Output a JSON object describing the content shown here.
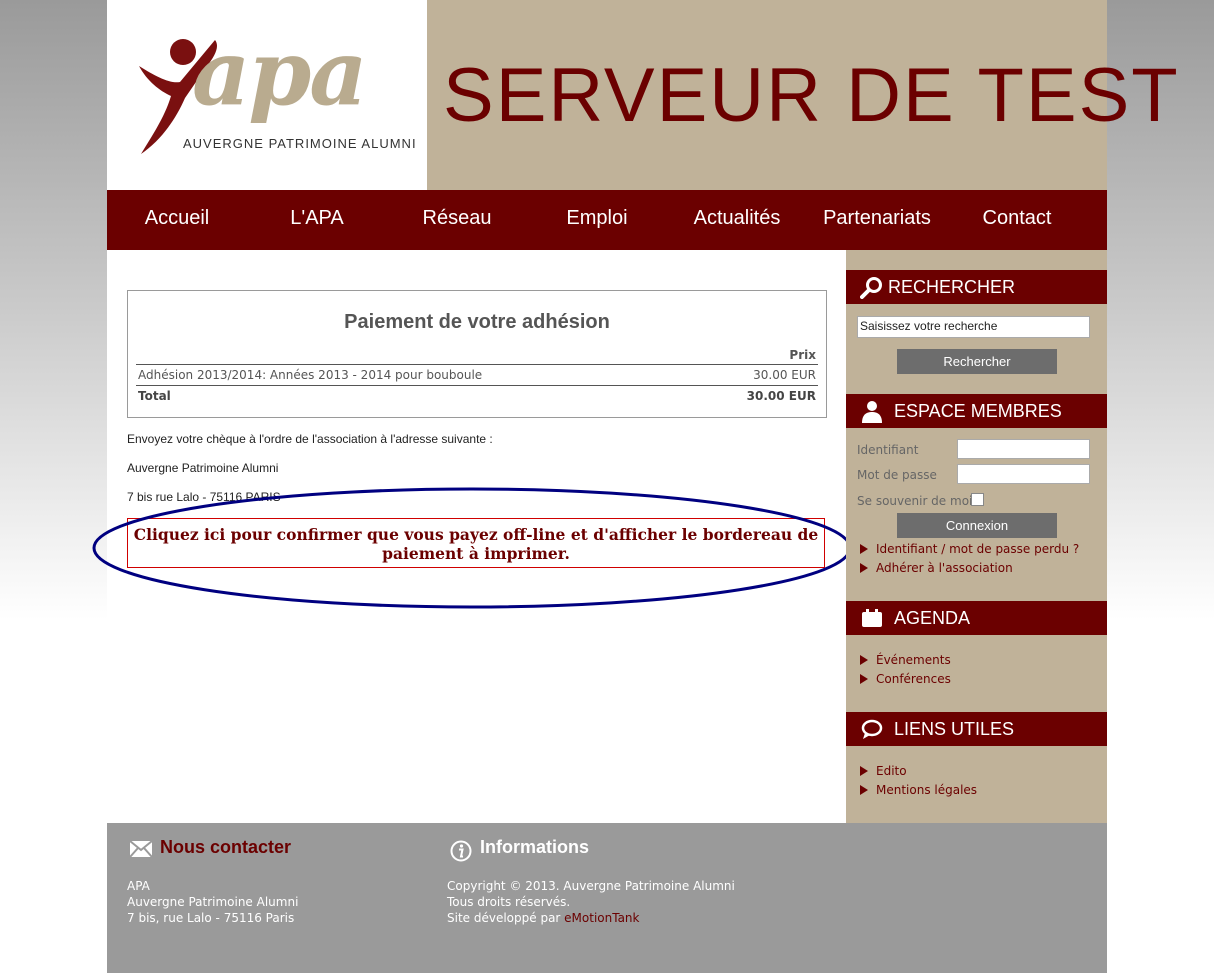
{
  "header": {
    "logo_text": "apa",
    "logo_subtitle": "AUVERGNE PATRIMOINE ALUMNI",
    "banner_title": "SERVEUR DE TEST"
  },
  "nav": {
    "items": [
      "Accueil",
      "L'APA",
      "Réseau",
      "Emploi",
      "Actualités",
      "Partenariats",
      "Contact"
    ]
  },
  "payment": {
    "title": "Paiement de votre adhésion",
    "price_header": "Prix",
    "item_label": "Adhésion 2013/2014: Années 2013 - 2014 pour bouboule",
    "item_price": "30.00 EUR",
    "total_label": "Total",
    "total_price": "30.00 EUR"
  },
  "instructions": {
    "line1": "Envoyez votre chèque à l'ordre de l'association à l'adresse suivante :",
    "line2": "Auvergne Patrimoine Alumni",
    "line3": "7 bis rue Lalo - 75116 PARIS",
    "confirm_line1": "Cliquez ici pour confirmer que vous payez off-line et d'afficher le bordereau de",
    "confirm_line2": "paiement à imprimer."
  },
  "sidebar": {
    "search": {
      "title": "RECHERCHER",
      "value": "Saisissez votre recherche",
      "button": "Rechercher"
    },
    "members": {
      "title": "ESPACE MEMBRES",
      "login_label": "Identifiant",
      "password_label": "Mot de passe",
      "remember_label": "Se souvenir de moi",
      "button": "Connexion",
      "links": [
        "Identifiant / mot de passe perdu ?",
        "Adhérer à l'association"
      ]
    },
    "agenda": {
      "title": "AGENDA",
      "links": [
        "Événements",
        "Conférences"
      ]
    },
    "liens": {
      "title": "LIENS UTILES",
      "links": [
        "Edito",
        "Mentions légales"
      ]
    }
  },
  "footer": {
    "contact_title": "Nous contacter",
    "contact_lines": [
      "APA",
      "Auvergne Patrimoine Alumni",
      "7 bis, rue Lalo - 75116 Paris"
    ],
    "info_title": "Informations",
    "info_lines": [
      "Copyright © 2013. Auvergne Patrimoine Alumni",
      "Tous droits réservés."
    ],
    "dev_prefix": "Site développé par ",
    "dev_link": "eMotionTank"
  },
  "colors": {
    "brand": "#6b0000",
    "beige": "#c0b299",
    "footer": "#9a9a9a",
    "highlight_ellipse": "#000080",
    "confirm_border": "#d00000"
  }
}
